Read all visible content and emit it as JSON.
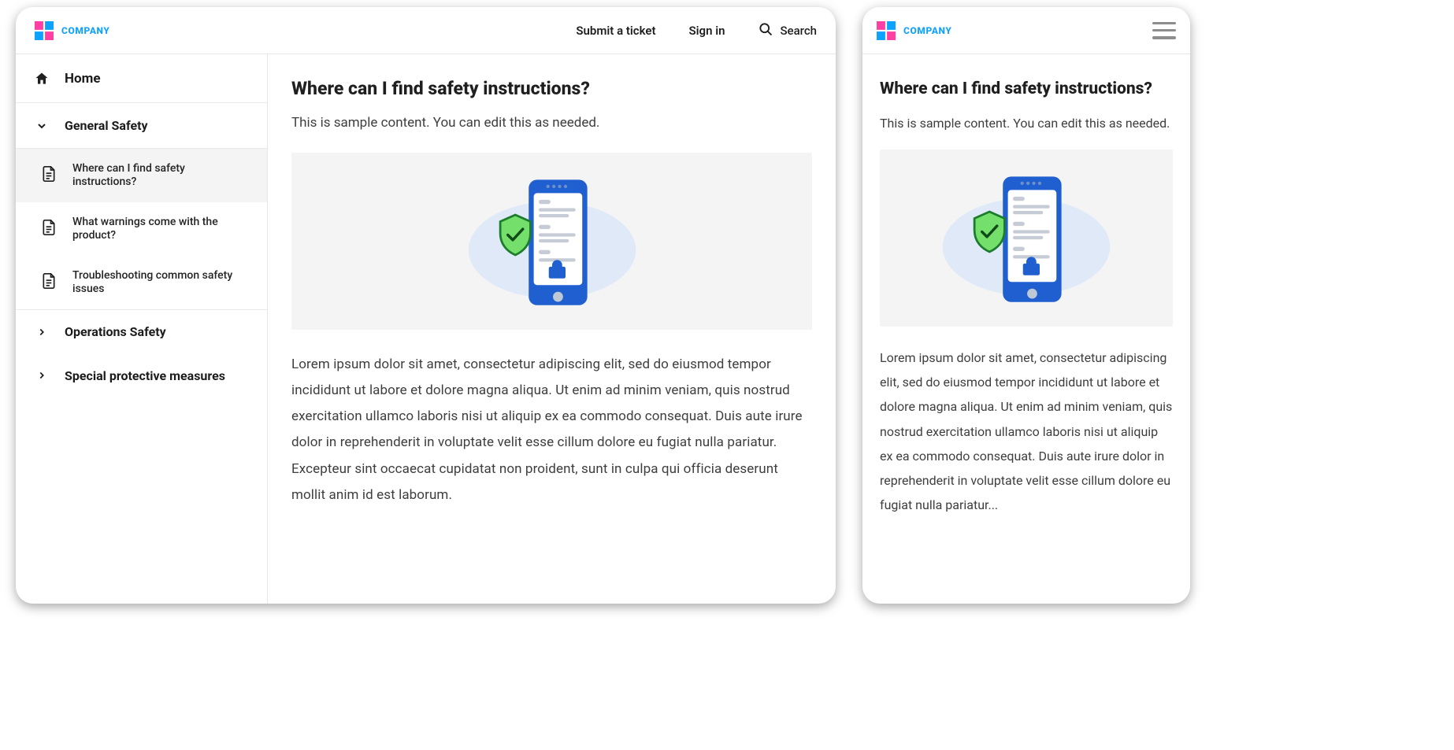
{
  "brand": {
    "name": "COMPANY"
  },
  "header": {
    "submit": "Submit a ticket",
    "signin": "Sign in",
    "search": "Search"
  },
  "sidebar": {
    "home": "Home",
    "cat_general": "General Safety",
    "cat_ops": "Operations Safety",
    "cat_spm": "Special protective measures",
    "articles": [
      {
        "label": "Where can I find safety instructions?"
      },
      {
        "label": "What warnings come with the product?"
      },
      {
        "label": "Troubleshooting common safety issues"
      }
    ]
  },
  "article": {
    "title": "Where can I find safety instructions?",
    "intro": "This is sample content. You can edit this as needed.",
    "body": "Lorem ipsum dolor sit amet, consectetur adipiscing elit, sed do eiusmod tempor incididunt ut labore et dolore magna aliqua. Ut enim ad minim veniam, quis nostrud exercitation ullamco laboris nisi ut aliquip ex ea commodo consequat. Duis aute irure dolor in reprehenderit in voluptate velit esse cillum dolore eu fugiat nulla pariatur. Excepteur sint occaecat cupidatat non proident, sunt in culpa qui officia deserunt mollit anim id est laborum."
  },
  "mobile": {
    "title": "Where can I find safety instructions?",
    "intro": "This is sample content. You can edit this as needed.",
    "body": "Lorem ipsum dolor sit amet, consectetur adipiscing elit, sed do eiusmod tempor incididunt ut labore et dolore magna aliqua. Ut enim ad minim veniam, quis nostrud exercitation ullamco laboris nisi ut aliquip ex ea commodo consequat. Duis aute irure dolor in reprehenderit in voluptate velit esse cillum dolore eu fugiat nulla pariatur..."
  }
}
